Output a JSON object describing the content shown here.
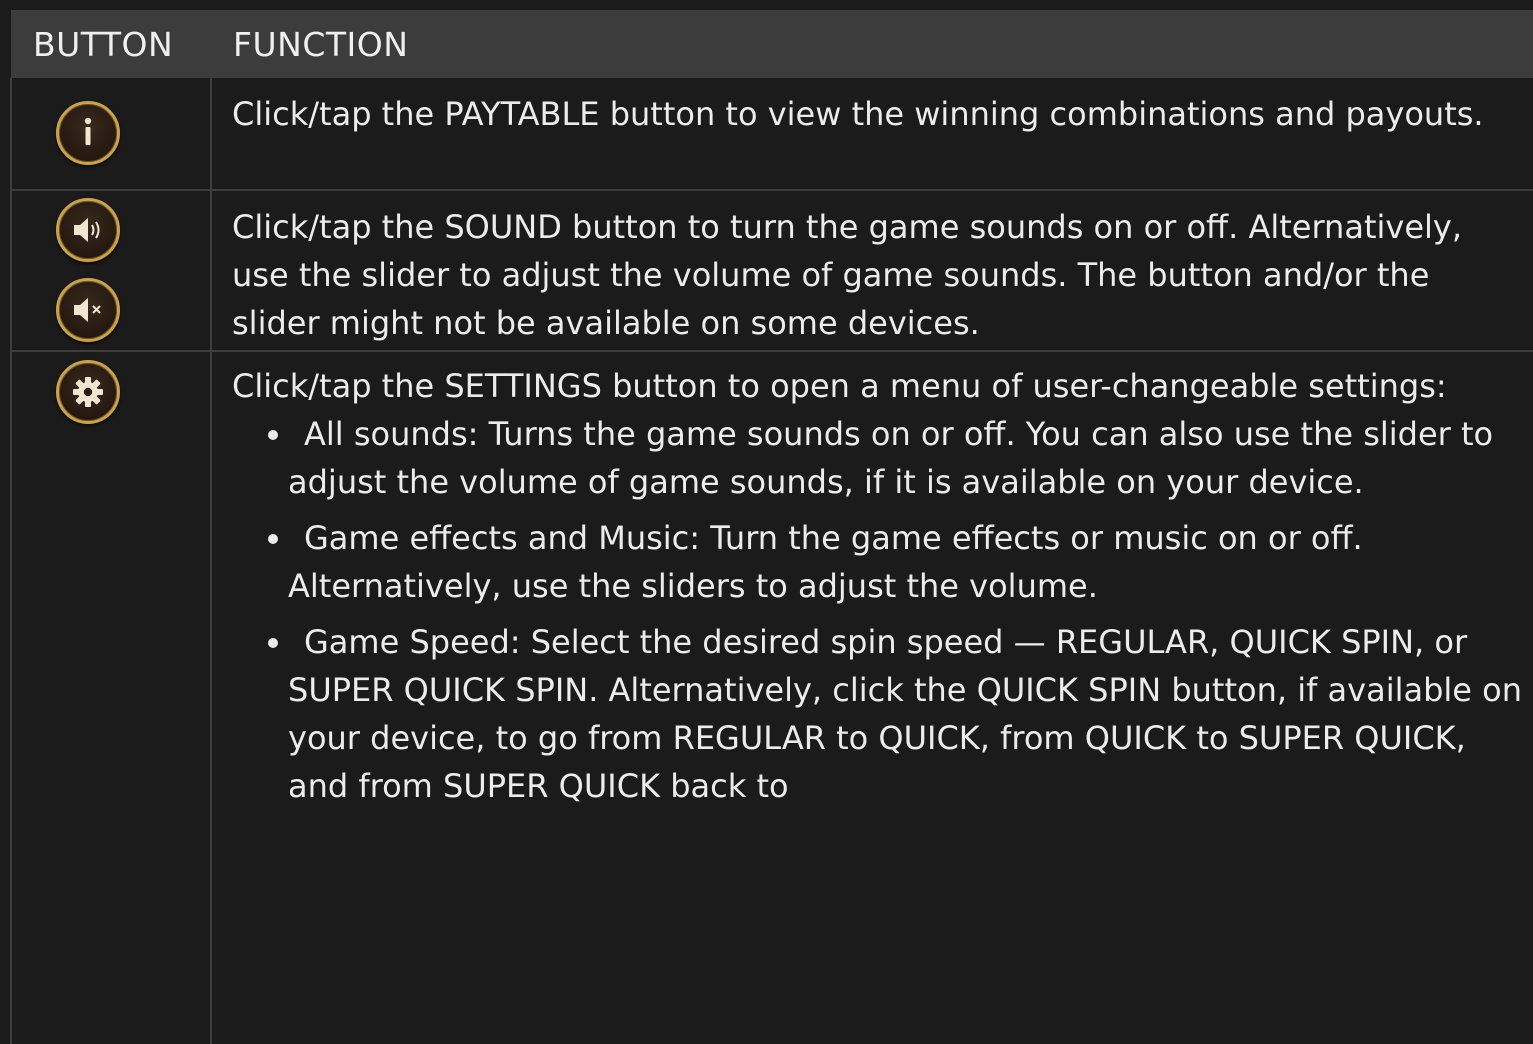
{
  "table": {
    "headers": {
      "button": "BUTTON",
      "function": "FUNCTION"
    },
    "rows": [
      {
        "icons": [
          "info-icon"
        ],
        "text": "Click/tap the PAYTABLE button to view the winning combinations and payouts."
      },
      {
        "icons": [
          "sound-on-icon",
          "sound-off-icon"
        ],
        "text": "Click/tap the SOUND button to turn the game sounds on or off. Alternatively, use the slider to adjust the volume of game sounds. The button and/or the slider might not be available on some devices."
      },
      {
        "icons": [
          "gear-icon"
        ],
        "intro": "Click/tap the SETTINGS button to open a menu of user-changeable settings:",
        "bullets": [
          "All sounds: Turns the game sounds on or off. You can also use the slider to adjust the volume of game sounds, if it is available on your device.",
          "Game effects and Music: Turn the game effects or music on or off. Alternatively, use the sliders to adjust the volume.",
          "Game Speed: Select the desired spin speed — REGULAR, QUICK SPIN, or SUPER QUICK SPIN. Alternatively, click the QUICK SPIN button, if available on your device, to go from REGULAR to QUICK, from QUICK to SUPER QUICK, and from SUPER QUICK back to"
        ]
      }
    ]
  },
  "colors": {
    "background": "#1b1b1b",
    "header": "#3c3c3c",
    "border": "#3e3e3e",
    "gold": "#c9a24a",
    "text": "#ececec"
  }
}
